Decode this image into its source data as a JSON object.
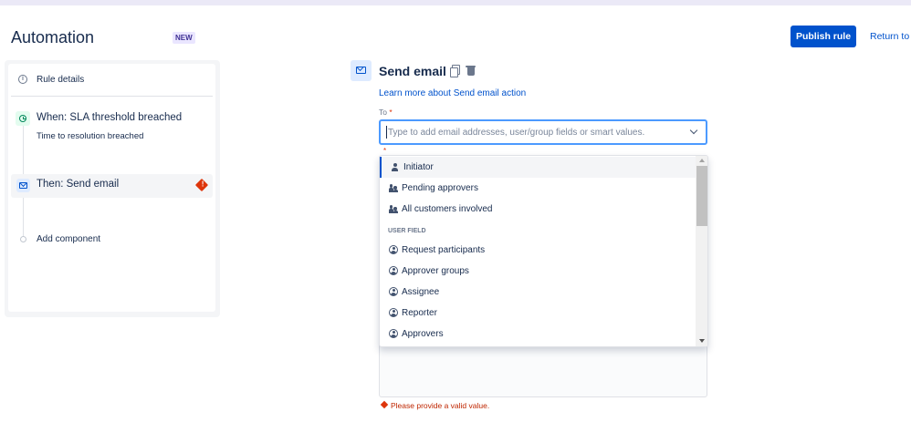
{
  "header": {
    "title": "Automation",
    "badge": "NEW",
    "publish_label": "Publish rule",
    "return_label": "Return to"
  },
  "sidebar": {
    "rule_details": "Rule details",
    "trigger": {
      "label": "When: SLA threshold breached",
      "sub": "Time to resolution breached"
    },
    "action": {
      "label": "Then: Send email",
      "error_symbol": "!"
    },
    "add_component": "Add component"
  },
  "editor": {
    "title": "Send email",
    "learn_more": "Learn more about Send email action",
    "to_label": "To",
    "required_marker": "*",
    "to_placeholder": "Type to add email addresses, user/group fields or smart values.",
    "error_message": "Please provide a valid value."
  },
  "dropdown": {
    "options": [
      {
        "label": "Initiator",
        "icon": "person-icon",
        "selected": true
      },
      {
        "label": "Pending approvers",
        "icon": "people-icon"
      },
      {
        "label": "All customers involved",
        "icon": "people-icon"
      }
    ],
    "group_header": "USER FIELD",
    "user_fields": [
      {
        "label": "Request participants",
        "icon": "user-circle-icon"
      },
      {
        "label": "Approver groups",
        "icon": "user-circle-icon"
      },
      {
        "label": "Assignee",
        "icon": "user-circle-icon"
      },
      {
        "label": "Reporter",
        "icon": "user-circle-icon"
      },
      {
        "label": "Approvers",
        "icon": "user-circle-icon"
      }
    ]
  },
  "colors": {
    "accent": "#0052cc",
    "error": "#de350b",
    "trigger_icon_bg": "#e3fcef",
    "action_icon_bg": "#deebff"
  }
}
